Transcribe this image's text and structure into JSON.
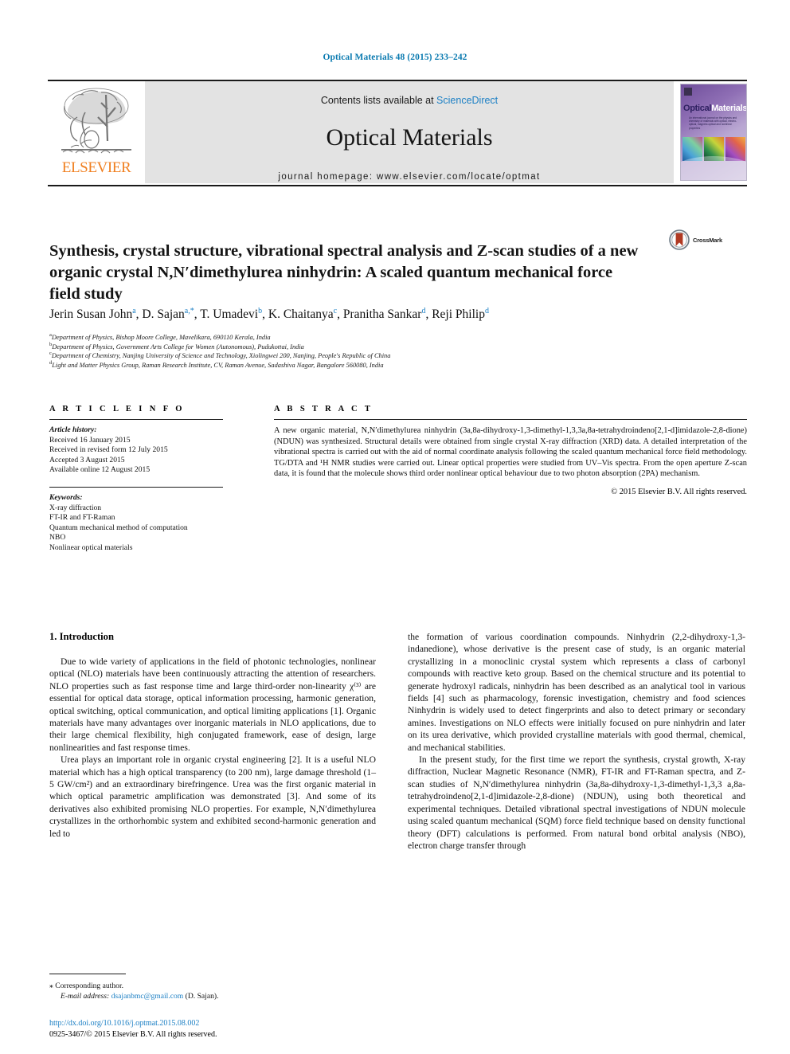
{
  "running_head": "Optical Materials 48 (2015) 233–242",
  "masthead": {
    "publisher": "ELSEVIER",
    "contents_prefix": "Contents lists available at ",
    "contents_link": "ScienceDirect",
    "journal_name": "Optical Materials",
    "homepage": "journal homepage: www.elsevier.com/locate/optmat",
    "cover": {
      "title_part1": "Optical",
      "title_part2": "Materials",
      "subtitle": "An international journal on the physics and chemistry of materials with optical, electro-optical, magneto-optical and nonlinear properties"
    }
  },
  "article": {
    "title": "Synthesis, crystal structure, vibrational spectral analysis and Z-scan studies of a new organic crystal N,N′dimethylurea ninhydrin: A scaled quantum mechanical force field study",
    "crossmark_label": "CrossMark",
    "authors": [
      {
        "name": "Jerin Susan John",
        "marks": "a"
      },
      {
        "name": "D. Sajan",
        "marks": "a,*"
      },
      {
        "name": "T. Umadevi",
        "marks": "b"
      },
      {
        "name": "K. Chaitanya",
        "marks": "c"
      },
      {
        "name": "Pranitha Sankar",
        "marks": "d"
      },
      {
        "name": "Reji Philip",
        "marks": "d"
      }
    ],
    "affiliations": [
      {
        "mark": "a",
        "text": "Department of Physics, Bishop Moore College, Mavelikara, 690110 Kerala, India"
      },
      {
        "mark": "b",
        "text": "Department of Physics, Government Arts College for Women (Autonomous), Pudukottai, India"
      },
      {
        "mark": "c",
        "text": "Department of Chemistry, Nanjing University of Science and Technology, Xiolingwei 200, Nanjing, People's Republic of China"
      },
      {
        "mark": "d",
        "text": "Light and Matter Physics Group, Raman Research Institute, CV, Raman Avenue, Sadashiva Nagar, Bangalore 560080, India"
      }
    ]
  },
  "article_info": {
    "heading": "A R T I C L E    I N F O",
    "history_label": "Article history:",
    "history": [
      "Received 16 January 2015",
      "Received in revised form 12 July 2015",
      "Accepted 3 August 2015",
      "Available online 12 August 2015"
    ],
    "keywords_label": "Keywords:",
    "keywords": [
      "X-ray diffraction",
      "FT-IR and FT-Raman",
      "Quantum mechanical method of computation",
      "NBO",
      "Nonlinear optical materials"
    ]
  },
  "abstract": {
    "heading": "A B S T R A C T",
    "text": "A new organic material, N,N′dimethylurea ninhydrin (3a,8a-dihydroxy-1,3-dimethyl-1,3,3a,8a-tetrahydroindeno[2,1-d]imidazole-2,8-dione) (NDUN) was synthesized. Structural details were obtained from single crystal X-ray diffraction (XRD) data. A detailed interpretation of the vibrational spectra is carried out with the aid of normal coordinate analysis following the scaled quantum mechanical force field methodology. TG/DTA and ¹H NMR studies were carried out. Linear optical properties were studied from UV–Vis spectra. From the open aperture Z-scan data, it is found that the molecule shows third order nonlinear optical behaviour due to two photon absorption (2PA) mechanism.",
    "copyright": "© 2015 Elsevier B.V. All rights reserved."
  },
  "introduction": {
    "section_number_title": "1. Introduction",
    "left_paragraphs": [
      "Due to wide variety of applications in the field of photonic technologies, nonlinear optical (NLO) materials have been continuously attracting the attention of researchers. NLO properties such as fast response time and large third-order non-linearity χ⁽³⁾ are essential for optical data storage, optical information processing, harmonic generation, optical switching, optical communication, and optical limiting applications [1]. Organic materials have many advantages over inorganic materials in NLO applications, due to their large chemical flexibility, high conjugated framework, ease of design, large nonlinearities and fast response times.",
      "Urea plays an important role in organic crystal engineering [2]. It is a useful NLO material which has a high optical transparency (to 200 nm), large damage threshold (1–5 GW/cm²) and an extraordinary birefringence. Urea was the first organic material in which optical parametric amplification was demonstrated [3]. And some of its derivatives also exhibited promising NLO properties. For example, N,N′dimethylurea crystallizes in the orthorhombic system and exhibited second-harmonic generation and led to"
    ],
    "right_paragraphs": [
      "the formation of various coordination compounds. Ninhydrin (2,2-dihydroxy-1,3-indanedione), whose derivative is the present case of study, is an organic material crystallizing in a monoclinic crystal system which represents a class of carbonyl compounds with reactive keto group. Based on the chemical structure and its potential to generate hydroxyl radicals, ninhydrin has been described as an analytical tool in various fields [4] such as pharmacology, forensic investigation, chemistry and food sciences Ninhydrin is widely used to detect fingerprints and also to detect primary or secondary amines. Investigations on NLO effects were initially focused on pure ninhydrin and later on its urea derivative, which provided crystalline materials with good thermal, chemical, and mechanical stabilities.",
      "In the present study, for the first time we report the synthesis, crystal growth, X-ray diffraction, Nuclear Magnetic Resonance (NMR), FT-IR and FT-Raman spectra, and Z-scan studies of N,N′dimethylurea ninhydrin (3a,8a-dihydroxy-1,3-dimethyl-1,3,3 a,8a-tetrahydroindeno[2,1-d]imidazole-2,8-dione) (NDUN), using both theoretical and experimental techniques. Detailed vibrational spectral investigations of NDUN molecule using scaled quantum mechanical (SQM) force field technique based on density functional theory (DFT) calculations is performed. From natural bond orbital analysis (NBO), electron charge transfer through"
    ]
  },
  "footnote": {
    "corresponding_mark": "⁎",
    "corresponding_text": "Corresponding author.",
    "email_label": "E-mail address:",
    "email": "dsajanbmc@gmail.com",
    "email_suffix": "(D. Sajan)."
  },
  "footer": {
    "doi": "http://dx.doi.org/10.1016/j.optmat.2015.08.002",
    "issn_line": "0925-3467/© 2015 Elsevier B.V. All rights reserved."
  },
  "colors": {
    "link_blue": "#1b7fc4",
    "running_head_blue": "#0a7ab0",
    "elsevier_orange": "#f07f20",
    "masthead_grey": "#e3e3e3"
  }
}
